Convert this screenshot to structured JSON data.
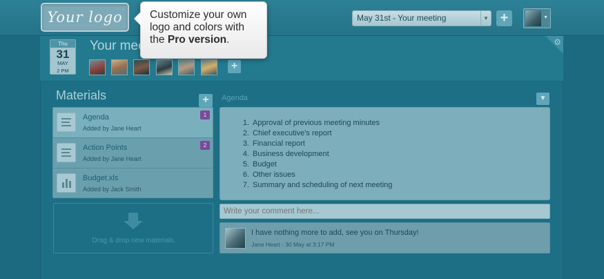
{
  "topbar": {
    "logo_text": "Your logo",
    "meeting_select_value": "May 31st - Your meeting",
    "add_meeting_label": "+"
  },
  "tooltip": {
    "line1": "Customize your own logo and colors with the ",
    "emphasis": "Pro version",
    "end": "."
  },
  "meeting": {
    "date": {
      "weekday": "Thu",
      "day": "31",
      "month": "MAY",
      "time": "2 PM"
    },
    "title": "Your meeting",
    "participants": [
      "participant-1",
      "participant-2",
      "participant-3",
      "participant-4",
      "participant-5",
      "participant-6"
    ],
    "add_participant_label": "+"
  },
  "materials": {
    "title": "Materials",
    "add_label": "+",
    "items": [
      {
        "name": "Agenda",
        "added_by": "Added by Jane Heart",
        "badge": "1",
        "icon": "document-icon"
      },
      {
        "name": "Action Points",
        "added_by": "Added by Jane Heart",
        "badge": "2",
        "icon": "document-icon"
      },
      {
        "name": "Budget.xls",
        "added_by": "Added by Jack Smith",
        "badge": "",
        "icon": "chart-icon"
      }
    ],
    "drop_text": "Drag & drop new materials."
  },
  "agenda": {
    "label": "Agenda",
    "items": [
      "Approval of previous meeting minutes",
      "Chief executive's report",
      "Financial report",
      "Business development",
      "Budget",
      "Other issues",
      "Summary and scheduling of next meeting"
    ]
  },
  "comments": {
    "placeholder": "Write your comment here...",
    "items": [
      {
        "text": "I have nothing more to add, see you on Thursday!",
        "meta": "Jane Heart - 30 May at 3:17 PM"
      }
    ]
  },
  "colors": {
    "background": "#1c6a80",
    "accent": "#5fa6b8",
    "badge": "#7a4b9c"
  }
}
